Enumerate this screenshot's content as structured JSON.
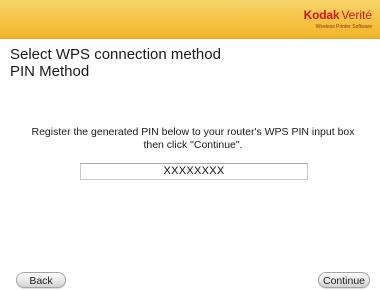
{
  "header": {
    "brand": "Kodak",
    "product": "Verité",
    "tagline": "Wireless Printer Software",
    "accent_color": "#f5c443",
    "brand_color": "#d3151f"
  },
  "main": {
    "title": "Select WPS connection method",
    "subtitle": "PIN Method",
    "instruction_line1": "Register the generated PIN below to your router's WPS PIN input box",
    "instruction_line2": "then click \"Continue\".",
    "pin_value": "XXXXXXXX"
  },
  "footer": {
    "back_label": "Back",
    "continue_label": "Continue"
  }
}
